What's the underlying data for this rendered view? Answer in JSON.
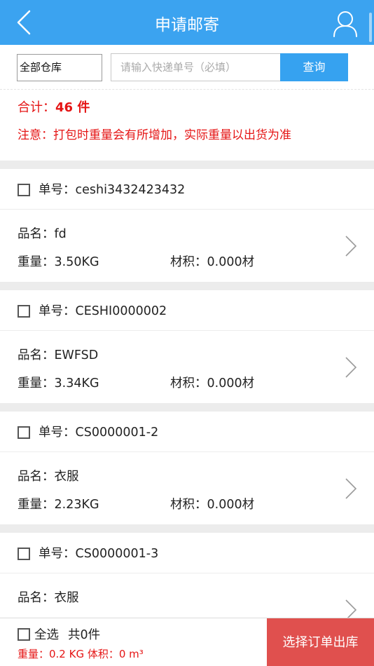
{
  "header": {
    "title": "申请邮寄",
    "colors": {
      "bar": "#3ba3f0",
      "accent_red": "#e51515",
      "submit": "#e0504e"
    }
  },
  "search": {
    "warehouse_value": "全部仓库",
    "tracking_placeholder": "请输入快递单号（必填）",
    "query_label": "查询"
  },
  "summary": {
    "total_label": "合计：",
    "total_value": "46 件",
    "notice": "注意：打包时重量会有所增加，实际重量以出货为准"
  },
  "items": [
    {
      "order_no": "单号：ceshi3432423432",
      "name": "品名：fd",
      "weight": "重量：3.50KG",
      "volume": "材积：0.000材"
    },
    {
      "order_no": "单号：CESHI0000002",
      "name": "品名：EWFSD",
      "weight": "重量：3.34KG",
      "volume": "材积：0.000材"
    },
    {
      "order_no": "单号：CS0000001-2",
      "name": "品名：衣服",
      "weight": "重量：2.23KG",
      "volume": "材积：0.000材"
    },
    {
      "order_no": "单号：CS0000001-3",
      "name": "品名：衣服",
      "weight": "",
      "volume": ""
    }
  ],
  "footer": {
    "select_all_label": "全选",
    "selected_count": "共0件",
    "totals": "重量：0.2 KG   体积：0 m³",
    "submit_label": "选择订单出库"
  }
}
